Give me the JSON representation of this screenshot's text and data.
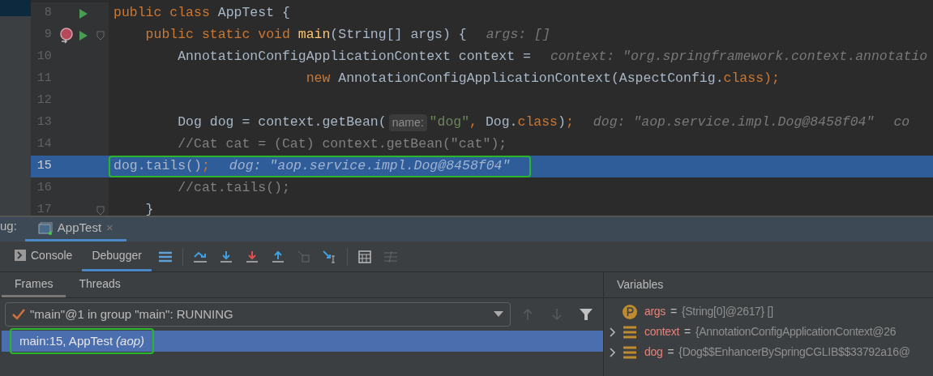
{
  "editor": {
    "lines": [
      {
        "number": "8",
        "run": true,
        "method_marker": false,
        "fold": false,
        "selected": false,
        "boxed": false,
        "tokens": [
          {
            "kind": "keyword",
            "text": "public class "
          },
          {
            "kind": "plain",
            "text": "AppTest {"
          }
        ]
      },
      {
        "number": "9",
        "run": true,
        "method_marker": true,
        "fold": true,
        "selected": false,
        "boxed": false,
        "tokens": [
          {
            "kind": "keyword",
            "text": "    public static void "
          },
          {
            "kind": "method",
            "text": "main"
          },
          {
            "kind": "plain",
            "text": "(String[] args) {"
          },
          {
            "kind": "hint",
            "text": "args: []"
          }
        ]
      },
      {
        "number": "10",
        "run": false,
        "method_marker": false,
        "fold": false,
        "selected": false,
        "boxed": false,
        "tokens": [
          {
            "kind": "plain",
            "text": "        AnnotationConfigApplicationContext context ="
          },
          {
            "kind": "hint",
            "text": "context: \"org.springframework.context.annotatio"
          }
        ]
      },
      {
        "number": "11",
        "run": false,
        "method_marker": false,
        "fold": false,
        "selected": false,
        "boxed": false,
        "tokens": [
          {
            "kind": "keyword",
            "text": "                        new "
          },
          {
            "kind": "plain",
            "text": "AnnotationConfigApplicationContext(AspectConfig."
          },
          {
            "kind": "keyword",
            "text": "class"
          },
          {
            "kind": "keyword",
            "text": ");"
          }
        ]
      },
      {
        "number": "12",
        "run": false,
        "method_marker": false,
        "fold": false,
        "selected": false,
        "boxed": false
      },
      {
        "number": "13",
        "run": false,
        "method_marker": false,
        "fold": false,
        "selected": false,
        "boxed": false,
        "tokens": [
          {
            "kind": "plain",
            "text": "        Dog dog = context.getBean("
          },
          {
            "kind": "param",
            "text": "name:"
          },
          {
            "kind": "string",
            "text": "\"dog\""
          },
          {
            "kind": "keyword",
            "text": ", "
          },
          {
            "kind": "plain",
            "text": "Dog."
          },
          {
            "kind": "keyword",
            "text": "class"
          },
          {
            "kind": "plain",
            "text": ")"
          },
          {
            "kind": "keyword",
            "text": ";"
          },
          {
            "kind": "hint",
            "text": "dog: \"aop.service.impl.Dog@8458f04\""
          },
          {
            "kind": "hint",
            "text": "co"
          }
        ]
      },
      {
        "number": "14",
        "run": false,
        "method_marker": false,
        "fold": false,
        "selected": false,
        "boxed": false,
        "tokens": [
          {
            "kind": "comment",
            "text": "        //Cat cat = (Cat) context.getBean(\"cat\");"
          }
        ]
      },
      {
        "number": "15",
        "run": false,
        "method_marker": false,
        "fold": false,
        "selected": true,
        "boxed": true,
        "tokens": [
          {
            "kind": "plain",
            "text": "        dog.tails()"
          },
          {
            "kind": "keyword",
            "text": ";"
          },
          {
            "kind": "hint",
            "text": "dog: \"aop.service.impl.Dog@8458f04\""
          }
        ]
      },
      {
        "number": "16",
        "run": false,
        "method_marker": false,
        "fold": false,
        "selected": false,
        "boxed": false,
        "tokens": [
          {
            "kind": "comment",
            "text": "        //cat.tails();"
          }
        ]
      },
      {
        "number": "17",
        "run": false,
        "method_marker": false,
        "fold": true,
        "selected": false,
        "boxed": false,
        "tokens": [
          {
            "kind": "plain",
            "text": "    }"
          }
        ]
      }
    ]
  },
  "debug_bar": {
    "label": "ug:",
    "tab": {
      "title": "AppTest",
      "close": "×",
      "selected": true
    }
  },
  "toolbar": {
    "tabs": [
      {
        "label": "Console",
        "selected": false
      },
      {
        "label": "Debugger",
        "selected": true
      }
    ]
  },
  "frames_panel": {
    "tabs": [
      {
        "label": "Frames",
        "selected": true
      },
      {
        "label": "Threads",
        "selected": false
      }
    ],
    "thread": "\"main\"@1 in group \"main\": RUNNING",
    "frames": [
      {
        "location": "main:15, AppTest",
        "package": "(aop)",
        "selected": true,
        "boxed": true
      }
    ]
  },
  "variables_panel": {
    "title": "Variables",
    "items": [
      {
        "kind": "param",
        "expandable": false,
        "name": "args",
        "operator": "=",
        "value": "{String[0]@2617} []"
      },
      {
        "kind": "field",
        "expandable": true,
        "name": "context",
        "operator": "=",
        "value": "{AnnotationConfigApplicationContext@26"
      },
      {
        "kind": "field",
        "expandable": true,
        "name": "dog",
        "operator": "=",
        "value": "{Dog$$EnhancerBySpringCGLIB$$33792a16@"
      }
    ]
  }
}
